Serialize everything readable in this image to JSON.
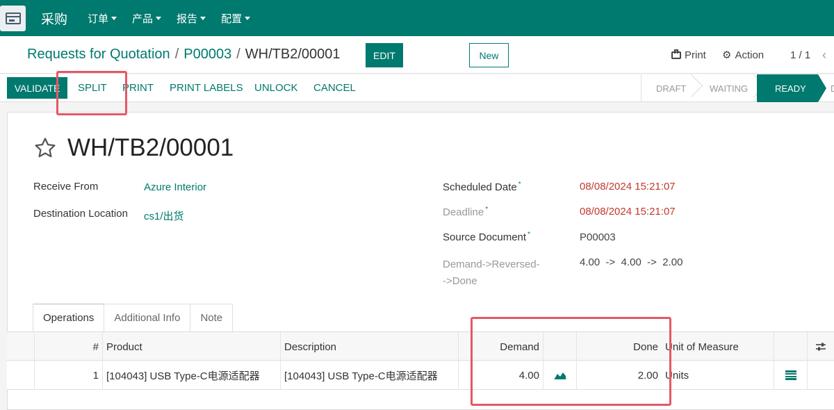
{
  "navbar": {
    "brand": "采购",
    "menu": [
      "订单",
      "产品",
      "报告",
      "配置"
    ]
  },
  "breadcrumb": {
    "root": "Requests for Quotation",
    "parent": "P00003",
    "current": "WH/TB2/00001",
    "separator": "/"
  },
  "control": {
    "edit_label": "EDIT",
    "new_label": "New",
    "print_label": "Print",
    "action_label": "Action",
    "pager": "1 / 1"
  },
  "statusbar": {
    "buttons": [
      "VALIDATE",
      "SPLIT",
      "PRINT",
      "PRINT LABELS",
      "UNLOCK",
      "CANCEL"
    ],
    "stages": [
      "DRAFT",
      "WAITING",
      "READY",
      "D"
    ],
    "active_stage": "READY"
  },
  "record": {
    "title": "WH/TB2/00001",
    "fields_left": [
      {
        "label": "Receive From",
        "value": "Azure Interior"
      },
      {
        "label": "Destination Location",
        "value": "cs1/出货"
      }
    ],
    "scheduled_date": {
      "label": "Scheduled Date",
      "value": "08/08/2024 15:21:07"
    },
    "deadline": {
      "label": "Deadline",
      "value": "08/08/2024 15:21:07"
    },
    "source_document": {
      "label": "Source Document",
      "value": "P00003"
    },
    "demand_flow": {
      "label_line1": "Demand->Reversed-",
      "label_line2": "->Done",
      "value": "4.00  ->  4.00  ->  2.00"
    },
    "required_mark": "*"
  },
  "tabs": [
    "Operations",
    "Additional Info",
    "Note"
  ],
  "table": {
    "headers": {
      "index": "#",
      "product": "Product",
      "description": "Description",
      "demand": "Demand",
      "done": "Done",
      "uom": "Unit of Measure"
    },
    "rows": [
      {
        "index": "1",
        "product": "[104043] USB Type-C电源适配器",
        "description": "[104043] USB Type-C电源适配器",
        "demand": "4.00",
        "done": "2.00",
        "uom": "Units"
      }
    ]
  },
  "icons": {
    "apps": "apps-icon",
    "star": "star-icon",
    "print": "printer-icon",
    "action": "gear-icon",
    "pager_prev": "chevron-left-icon",
    "forecast": "area-chart-icon",
    "detail": "list-icon",
    "optional_columns": "sliders-icon"
  },
  "colors": {
    "primary": "#00796e",
    "date_red": "#c0392b",
    "highlight": "#e45866"
  }
}
